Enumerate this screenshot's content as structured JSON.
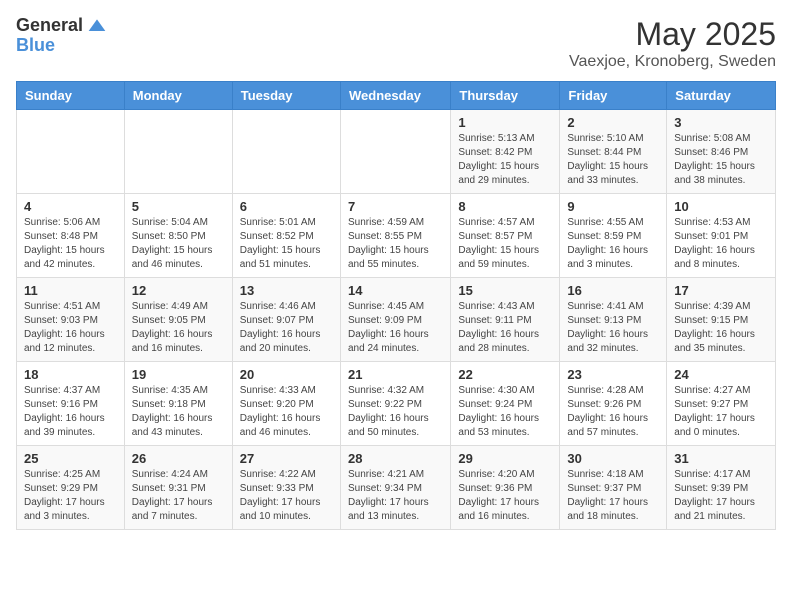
{
  "header": {
    "logo_general": "General",
    "logo_blue": "Blue",
    "month": "May 2025",
    "location": "Vaexjoe, Kronoberg, Sweden"
  },
  "weekdays": [
    "Sunday",
    "Monday",
    "Tuesday",
    "Wednesday",
    "Thursday",
    "Friday",
    "Saturday"
  ],
  "weeks": [
    [
      {
        "day": "",
        "info": ""
      },
      {
        "day": "",
        "info": ""
      },
      {
        "day": "",
        "info": ""
      },
      {
        "day": "",
        "info": ""
      },
      {
        "day": "1",
        "info": "Sunrise: 5:13 AM\nSunset: 8:42 PM\nDaylight: 15 hours\nand 29 minutes."
      },
      {
        "day": "2",
        "info": "Sunrise: 5:10 AM\nSunset: 8:44 PM\nDaylight: 15 hours\nand 33 minutes."
      },
      {
        "day": "3",
        "info": "Sunrise: 5:08 AM\nSunset: 8:46 PM\nDaylight: 15 hours\nand 38 minutes."
      }
    ],
    [
      {
        "day": "4",
        "info": "Sunrise: 5:06 AM\nSunset: 8:48 PM\nDaylight: 15 hours\nand 42 minutes."
      },
      {
        "day": "5",
        "info": "Sunrise: 5:04 AM\nSunset: 8:50 PM\nDaylight: 15 hours\nand 46 minutes."
      },
      {
        "day": "6",
        "info": "Sunrise: 5:01 AM\nSunset: 8:52 PM\nDaylight: 15 hours\nand 51 minutes."
      },
      {
        "day": "7",
        "info": "Sunrise: 4:59 AM\nSunset: 8:55 PM\nDaylight: 15 hours\nand 55 minutes."
      },
      {
        "day": "8",
        "info": "Sunrise: 4:57 AM\nSunset: 8:57 PM\nDaylight: 15 hours\nand 59 minutes."
      },
      {
        "day": "9",
        "info": "Sunrise: 4:55 AM\nSunset: 8:59 PM\nDaylight: 16 hours\nand 3 minutes."
      },
      {
        "day": "10",
        "info": "Sunrise: 4:53 AM\nSunset: 9:01 PM\nDaylight: 16 hours\nand 8 minutes."
      }
    ],
    [
      {
        "day": "11",
        "info": "Sunrise: 4:51 AM\nSunset: 9:03 PM\nDaylight: 16 hours\nand 12 minutes."
      },
      {
        "day": "12",
        "info": "Sunrise: 4:49 AM\nSunset: 9:05 PM\nDaylight: 16 hours\nand 16 minutes."
      },
      {
        "day": "13",
        "info": "Sunrise: 4:46 AM\nSunset: 9:07 PM\nDaylight: 16 hours\nand 20 minutes."
      },
      {
        "day": "14",
        "info": "Sunrise: 4:45 AM\nSunset: 9:09 PM\nDaylight: 16 hours\nand 24 minutes."
      },
      {
        "day": "15",
        "info": "Sunrise: 4:43 AM\nSunset: 9:11 PM\nDaylight: 16 hours\nand 28 minutes."
      },
      {
        "day": "16",
        "info": "Sunrise: 4:41 AM\nSunset: 9:13 PM\nDaylight: 16 hours\nand 32 minutes."
      },
      {
        "day": "17",
        "info": "Sunrise: 4:39 AM\nSunset: 9:15 PM\nDaylight: 16 hours\nand 35 minutes."
      }
    ],
    [
      {
        "day": "18",
        "info": "Sunrise: 4:37 AM\nSunset: 9:16 PM\nDaylight: 16 hours\nand 39 minutes."
      },
      {
        "day": "19",
        "info": "Sunrise: 4:35 AM\nSunset: 9:18 PM\nDaylight: 16 hours\nand 43 minutes."
      },
      {
        "day": "20",
        "info": "Sunrise: 4:33 AM\nSunset: 9:20 PM\nDaylight: 16 hours\nand 46 minutes."
      },
      {
        "day": "21",
        "info": "Sunrise: 4:32 AM\nSunset: 9:22 PM\nDaylight: 16 hours\nand 50 minutes."
      },
      {
        "day": "22",
        "info": "Sunrise: 4:30 AM\nSunset: 9:24 PM\nDaylight: 16 hours\nand 53 minutes."
      },
      {
        "day": "23",
        "info": "Sunrise: 4:28 AM\nSunset: 9:26 PM\nDaylight: 16 hours\nand 57 minutes."
      },
      {
        "day": "24",
        "info": "Sunrise: 4:27 AM\nSunset: 9:27 PM\nDaylight: 17 hours\nand 0 minutes."
      }
    ],
    [
      {
        "day": "25",
        "info": "Sunrise: 4:25 AM\nSunset: 9:29 PM\nDaylight: 17 hours\nand 3 minutes."
      },
      {
        "day": "26",
        "info": "Sunrise: 4:24 AM\nSunset: 9:31 PM\nDaylight: 17 hours\nand 7 minutes."
      },
      {
        "day": "27",
        "info": "Sunrise: 4:22 AM\nSunset: 9:33 PM\nDaylight: 17 hours\nand 10 minutes."
      },
      {
        "day": "28",
        "info": "Sunrise: 4:21 AM\nSunset: 9:34 PM\nDaylight: 17 hours\nand 13 minutes."
      },
      {
        "day": "29",
        "info": "Sunrise: 4:20 AM\nSunset: 9:36 PM\nDaylight: 17 hours\nand 16 minutes."
      },
      {
        "day": "30",
        "info": "Sunrise: 4:18 AM\nSunset: 9:37 PM\nDaylight: 17 hours\nand 18 minutes."
      },
      {
        "day": "31",
        "info": "Sunrise: 4:17 AM\nSunset: 9:39 PM\nDaylight: 17 hours\nand 21 minutes."
      }
    ]
  ]
}
